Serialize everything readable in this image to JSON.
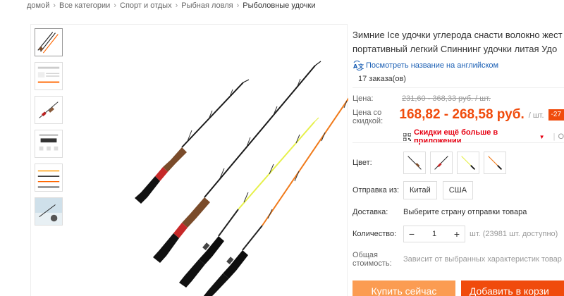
{
  "breadcrumb": [
    {
      "label": "домой"
    },
    {
      "label": "Все категории"
    },
    {
      "label": "Спорт и отдых"
    },
    {
      "label": "Рыбная ловля"
    },
    {
      "label": "Рыболовные удочки"
    }
  ],
  "product": {
    "title_line1": "Зимние Ice удочки углерода снасти волокно жест",
    "title_line2": "портативный легкий Спиннинг удочки литая Удо",
    "translate_link": "Посмотреть название на английском",
    "orders": "17 заказа(ов)"
  },
  "price": {
    "old_label": "Цена:",
    "old_value": "231,60 - 368,33 руб. / шт.",
    "new_label_line1": "Цена со",
    "new_label_line2": "скидкой:",
    "new_value": "168,82 - 268,58 руб.",
    "per_unit": "/ шт.",
    "discount": "-27",
    "app_promo": "Скидки ещё больше в приложении",
    "promo_more": "О"
  },
  "options": {
    "color_label": "Цвет:",
    "ship_from_label": "Отправка из:",
    "ship_from_options": [
      "Китай",
      "США"
    ],
    "delivery_label": "Доставка:",
    "delivery_value": "Выберите страну отправки товара",
    "quantity_label": "Количество:",
    "quantity_value": "1",
    "quantity_minus": "−",
    "quantity_plus": "+",
    "quantity_note": "шт. (23981 шт. доступно)",
    "total_label_line1": "Общая",
    "total_label_line2": "стоимость:",
    "total_value": "Зависит от выбранных характеристик товар"
  },
  "actions": {
    "buy_now": "Купить сейчас",
    "add_to_cart": "Добавить в корзи"
  },
  "colors": {
    "accent": "#f04b0c",
    "buy_button": "#fb9c52",
    "promo": "#e60012",
    "link": "#1a5fb4"
  }
}
